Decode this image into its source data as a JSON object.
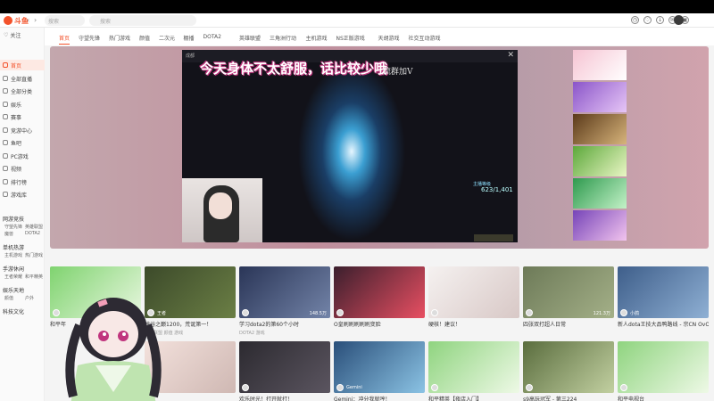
{
  "app": {
    "logo_text": "斗鱼"
  },
  "titlebar": {
    "back": "‹",
    "forward": "›",
    "refresh": "↻",
    "search_placeholder": "搜索",
    "search2_placeholder": "搜索",
    "badge": "99"
  },
  "sidebar": {
    "user": "关注",
    "items": [
      {
        "label": "首页",
        "active": true
      },
      {
        "label": "全部直播"
      },
      {
        "label": "全部分类"
      },
      {
        "label": "娱乐"
      },
      {
        "label": "赛事"
      },
      {
        "label": "竞游中心"
      },
      {
        "label": "鱼吧"
      },
      {
        "label": "PC游戏"
      },
      {
        "label": "视频"
      },
      {
        "label": "排行榜"
      },
      {
        "label": "游戏库"
      }
    ],
    "sections": [
      {
        "head": "网游竞技",
        "subs": [
          "守望先锋",
          "英雄联盟",
          "魔兽",
          "DOTA2"
        ]
      },
      {
        "head": "单机热游",
        "subs": [
          "主机游戏",
          "热门游戏"
        ]
      },
      {
        "head": "手游休闲",
        "subs": [
          "王者荣耀",
          "和平精英"
        ]
      },
      {
        "head": "娱乐天地",
        "subs": [
          "颜值",
          "户外"
        ]
      },
      {
        "head": "科技文化",
        "subs": []
      }
    ]
  },
  "categories": [
    "首页",
    "守望先锋",
    "热门游戏",
    "颜值",
    "二次元",
    "棚播",
    "DOTA2",
    "英雄联盟",
    "三角洲行动",
    "主机游戏",
    "NS正版游戏",
    "天胡游戏",
    "社交互动游戏"
  ],
  "player": {
    "title": "成都",
    "banner": "今天身体不太舒服，话比较少哦",
    "subtitle": "流群加V",
    "hud_label": "主播等级",
    "hud_value": "623/1,401"
  },
  "cards": [
    {
      "title": "和平年",
      "tags": "",
      "name": "",
      "views": ""
    },
    {
      "title": "峡谷之巅1200，荒诞第一！",
      "tags": "英雄联盟 颜值 游戏",
      "name": "王者",
      "views": ""
    },
    {
      "title": "学习dota2的第60个小时",
      "tags": "DOTA2 游戏",
      "name": "",
      "views": "148.5万"
    },
    {
      "title": "O皇刷刷刷刷刷变脸",
      "tags": "",
      "name": "",
      "views": ""
    },
    {
      "title": "硬核！建议！",
      "tags": "",
      "name": "",
      "views": ""
    },
    {
      "title": "四张双打超人日常",
      "tags": "",
      "name": "",
      "views": "121.3万"
    },
    {
      "title": "新人dota王技大品鸭路线 - 宗CN OvO",
      "tags": "",
      "name": "小鸽",
      "views": ""
    },
    {
      "title": "",
      "tags": "",
      "name": "",
      "views": ""
    },
    {
      "title": "欢乐时光！打开就打！",
      "tags": "",
      "name": "",
      "views": ""
    },
    {
      "title": "Gemini：冲分我就哼！",
      "tags": "",
      "name": "Gemini",
      "views": ""
    },
    {
      "title": "和平精英【夜店入门】",
      "tags": "",
      "name": "",
      "views": ""
    },
    {
      "title": "s9高玩冠军 - 第三224",
      "tags": "",
      "name": "",
      "views": ""
    },
    {
      "title": "和平电视台",
      "tags": "",
      "name": "",
      "views": ""
    }
  ],
  "colors": {
    "accent": "#f3522b",
    "hero": "#c08e9c"
  }
}
